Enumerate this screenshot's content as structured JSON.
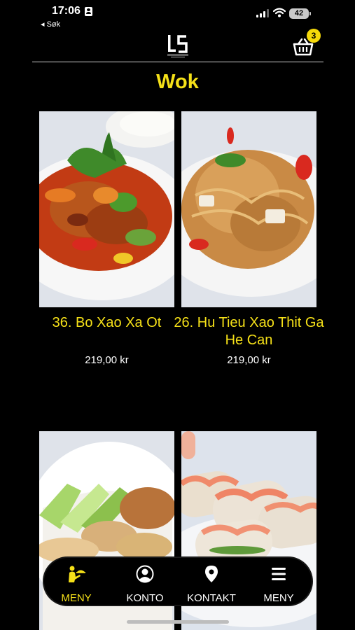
{
  "status_bar": {
    "time": "17:06",
    "back_label": "◂ Søk",
    "battery": "42"
  },
  "header": {
    "cart_count": "3",
    "icons": [
      "person-icon",
      "signal-icon",
      "wifi-icon",
      "battery-icon",
      "logo",
      "cart-icon"
    ]
  },
  "page": {
    "title": "Wok"
  },
  "products": [
    {
      "name": "36. Bo Xao Xa Ot",
      "price": "219,00 kr"
    },
    {
      "name": "26. Hu Tieu Xao Thit Ga He Can",
      "price": "219,00 kr"
    },
    {
      "name": "",
      "price": ""
    },
    {
      "name": "",
      "price": ""
    }
  ],
  "nav": {
    "items": [
      {
        "label": "MENY",
        "icon": "waiter-icon",
        "active": true
      },
      {
        "label": "KONTO",
        "icon": "account-icon",
        "active": false
      },
      {
        "label": "KONTAKT",
        "icon": "location-pin-icon",
        "active": false
      },
      {
        "label": "MENY",
        "icon": "hamburger-menu-icon",
        "active": false
      }
    ]
  },
  "colors": {
    "accent": "#f5e018",
    "background": "#000000",
    "badge": "#f5d90a"
  }
}
